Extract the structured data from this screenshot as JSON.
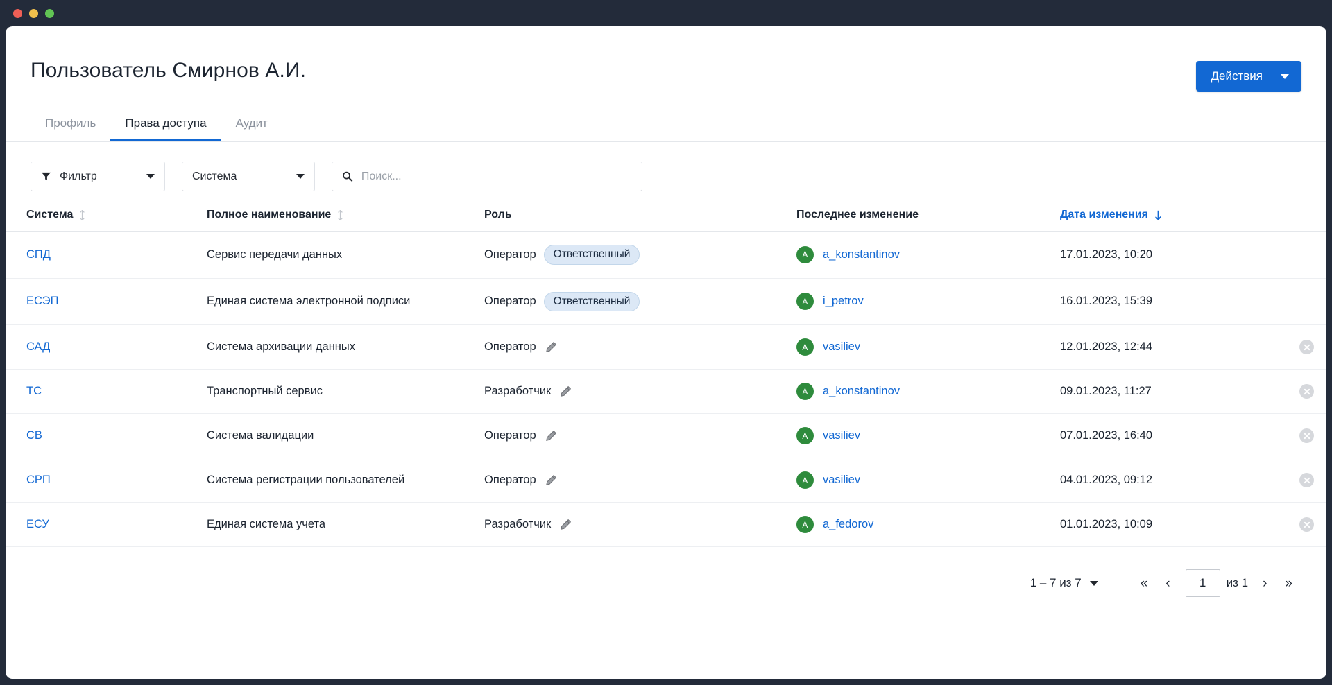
{
  "window": {
    "traffic_lights": [
      "close",
      "minimize",
      "zoom"
    ]
  },
  "header": {
    "title": "Пользователь Смирнов А.И.",
    "actions_button": "Действия",
    "actions_caret_icon": "chevron-down-icon"
  },
  "tabs": [
    {
      "label": "Профиль",
      "active": false
    },
    {
      "label": "Права доступа",
      "active": true
    },
    {
      "label": "Аудит",
      "active": false
    }
  ],
  "filters": {
    "filter_label": "Фильтр",
    "filter_icon": "funnel-icon",
    "system_label": "Система",
    "search_placeholder": "Поиск...",
    "search_value": "",
    "search_icon": "search-icon",
    "dropdown_icon": "chevron-down-icon"
  },
  "table": {
    "columns": [
      {
        "label": "Система",
        "sortable": true,
        "sorted": false,
        "sort_icon": "sort-updown-icon"
      },
      {
        "label": "Полное наименование",
        "sortable": true,
        "sorted": false,
        "sort_icon": "sort-updown-icon"
      },
      {
        "label": "Роль",
        "sortable": false,
        "sorted": false
      },
      {
        "label": "Последнее изменение",
        "sortable": false,
        "sorted": false
      },
      {
        "label": "Дата изменения",
        "sortable": true,
        "sorted": true,
        "sort_icon": "arrow-down-icon",
        "sort_direction": "desc"
      }
    ],
    "rows": [
      {
        "system": "СПД",
        "name": "Сервис передачи данных",
        "role": "Оператор",
        "badge": "Ответственный",
        "has_edit": false,
        "user": "a_konstantinov",
        "avatar_initial": "A",
        "date": "17.01.2023, 10:20",
        "has_remove": false
      },
      {
        "system": "ЕСЭП",
        "name": "Единая система электронной подписи",
        "role": "Оператор",
        "badge": "Ответственный",
        "has_edit": false,
        "user": "i_petrov",
        "avatar_initial": "A",
        "date": "16.01.2023, 15:39",
        "has_remove": false
      },
      {
        "system": "САД",
        "name": "Система архивации данных",
        "role": "Оператор",
        "badge": null,
        "has_edit": true,
        "user": "vasiliev",
        "avatar_initial": "A",
        "date": "12.01.2023, 12:44",
        "has_remove": true
      },
      {
        "system": "ТС",
        "name": "Транспортный сервис",
        "role": "Разработчик",
        "badge": null,
        "has_edit": true,
        "user": "a_konstantinov",
        "avatar_initial": "A",
        "date": "09.01.2023, 11:27",
        "has_remove": true
      },
      {
        "system": "СВ",
        "name": "Система валидации",
        "role": "Оператор",
        "badge": null,
        "has_edit": true,
        "user": "vasiliev",
        "avatar_initial": "A",
        "date": "07.01.2023, 16:40",
        "has_remove": true
      },
      {
        "system": "СРП",
        "name": "Система регистрации пользователей",
        "role": "Оператор",
        "badge": null,
        "has_edit": true,
        "user": "vasiliev",
        "avatar_initial": "A",
        "date": "04.01.2023, 09:12",
        "has_remove": true
      },
      {
        "system": "ЕСУ",
        "name": "Единая система учета",
        "role": "Разработчик",
        "badge": null,
        "has_edit": true,
        "user": "a_fedorov",
        "avatar_initial": "A",
        "date": "01.01.2023, 10:09",
        "has_remove": true
      }
    ]
  },
  "pagination": {
    "range_label": "1 – 7 из 7",
    "range_caret_icon": "caret-down-icon",
    "first_label": "«",
    "prev_label": "‹",
    "page_value": "1",
    "total_label": "из 1",
    "next_label": "›",
    "last_label": "»"
  },
  "colors": {
    "chrome": "#232b3a",
    "accent": "#1268d3",
    "avatar_green": "#2e8b3c",
    "badge_bg": "#dce8f6",
    "text": "#1c2430",
    "muted": "#8a919c"
  }
}
